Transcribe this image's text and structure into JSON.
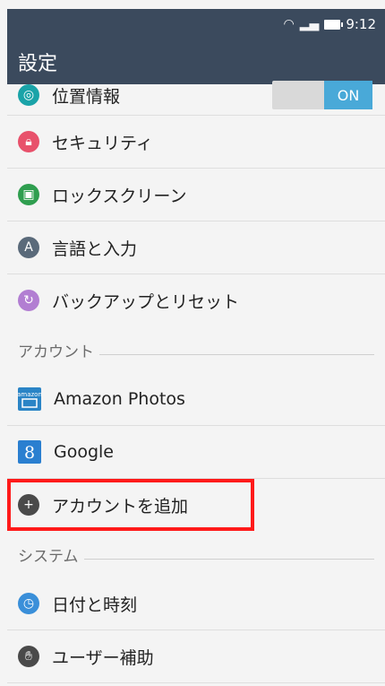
{
  "status": {
    "time": "9:12"
  },
  "header": {
    "title": "設定"
  },
  "rows_top": [
    {
      "label": "位置情報",
      "icon": "location-icon",
      "color": "#1aa3a8",
      "toggle": "ON"
    },
    {
      "label": "セキュリティ",
      "icon": "lock-icon",
      "color": "#e8516b"
    },
    {
      "label": "ロックスクリーン",
      "icon": "lockscreen-icon",
      "color": "#2f9e4f"
    },
    {
      "label": "言語と入力",
      "icon": "language-icon",
      "color": "#5a6a7a"
    },
    {
      "label": "バックアップとリセット",
      "icon": "backup-icon",
      "color": "#b27ed2"
    }
  ],
  "sections": {
    "accounts": "アカウント",
    "system": "システム"
  },
  "accounts": [
    {
      "label": "Amazon Photos",
      "icon": "amazon-photos-icon",
      "icon_text": "amazon"
    },
    {
      "label": "Google",
      "icon": "google-icon",
      "icon_text": "8"
    },
    {
      "label": "アカウントを追加",
      "icon": "add-icon",
      "color": "#4a4a4a"
    }
  ],
  "system": [
    {
      "label": "日付と時刻",
      "icon": "clock-icon",
      "color": "#3a8fd9"
    },
    {
      "label": "ユーザー補助",
      "icon": "hand-icon",
      "color": "#4a4a4a"
    }
  ],
  "colors": {
    "appbar": "#3b4a5d",
    "toggle_on": "#49a9d8",
    "highlight": "#ff1a1a"
  }
}
